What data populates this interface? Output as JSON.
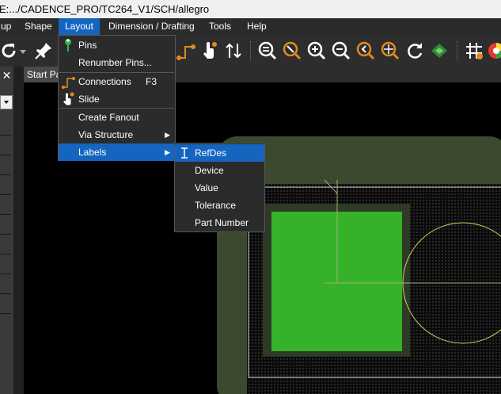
{
  "window": {
    "title": "E:.../CADENCE_PRO/TC264_V1/SCH/allegro"
  },
  "menubar": {
    "items": [
      {
        "label": "up"
      },
      {
        "label": "Shape"
      },
      {
        "label": "Layout"
      },
      {
        "label": "Dimension / Drafting"
      },
      {
        "label": "Tools"
      },
      {
        "label": "Help"
      }
    ]
  },
  "toolbar": {
    "icons": [
      "undo-icon",
      "dropdown-icon",
      "pin-icon",
      "route-icon",
      "slide-icon",
      "swap-icon",
      "zoom-points-icon",
      "zoom-fit-icon",
      "zoom-in-icon",
      "zoom-out-icon",
      "zoom-world-icon",
      "zoom-center-icon",
      "redraw-icon",
      "3d-view-icon",
      "grid-icon",
      "color-icon"
    ]
  },
  "left_panel": {
    "close_label": "✕"
  },
  "tabs": [
    {
      "label": "Start Pa"
    }
  ],
  "layout_menu": {
    "items": [
      {
        "label": "Pins",
        "icon": "pin-icon"
      },
      {
        "label": "Renumber Pins..."
      },
      {
        "label": "Connections",
        "shortcut": "F3",
        "icon": "connections-icon"
      },
      {
        "label": "Slide",
        "icon": "slide-icon"
      },
      {
        "label": "Create Fanout"
      },
      {
        "label": "Via Structure",
        "submenu": true
      },
      {
        "label": "Labels",
        "submenu": true,
        "highlighted": true
      }
    ]
  },
  "labels_submenu": {
    "items": [
      {
        "label": "RefDes",
        "icon": "text-cursor-icon",
        "highlighted": true
      },
      {
        "label": "Device"
      },
      {
        "label": "Value"
      },
      {
        "label": "Tolerance"
      },
      {
        "label": "Part Number"
      }
    ]
  },
  "colors": {
    "menu_bg": "#2b2b2b",
    "highlight": "#1565c0",
    "board_outer": "#3b4a2e",
    "pad_green": "#35b22a",
    "pad_border": "#2f3a26"
  }
}
